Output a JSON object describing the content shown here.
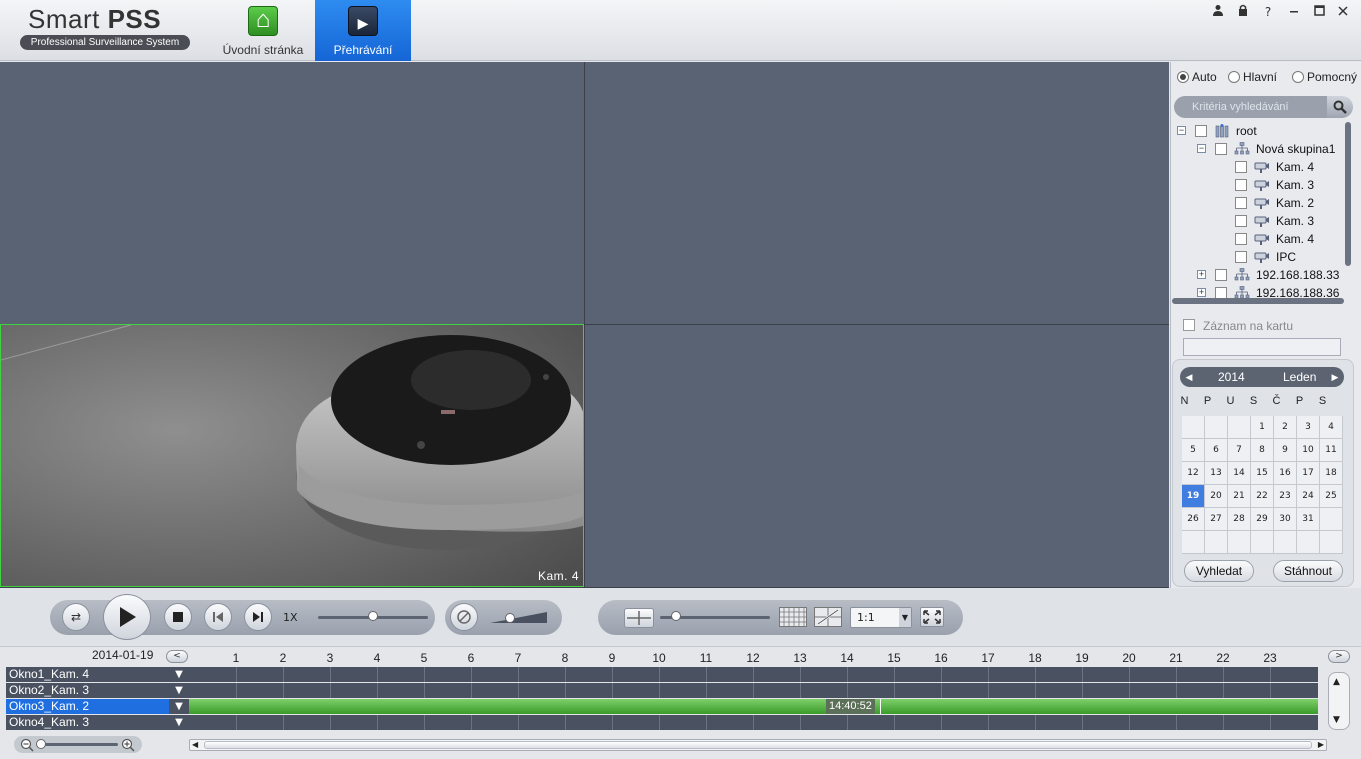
{
  "header": {
    "brand": "Smart",
    "brand_bold": "PSS",
    "subtitle": "Professional Surveillance System",
    "tabs": [
      {
        "label": "Úvodní stránka",
        "active": false
      },
      {
        "label": "Přehrávání",
        "active": true
      }
    ],
    "window_controls": [
      "user-icon",
      "lock-icon",
      "help-icon",
      "minimize-icon",
      "maximize-icon",
      "close-icon"
    ],
    "help_glyph": "?"
  },
  "video": {
    "active_pane_label": "Kam. 4"
  },
  "right_panel": {
    "stream_options": [
      {
        "label": "Auto",
        "checked": true
      },
      {
        "label": "Hlavní",
        "checked": false
      },
      {
        "label": "Pomocný",
        "checked": false
      }
    ],
    "search_placeholder": "Kritéria vyhledávání",
    "tree": [
      {
        "label": "root",
        "level": 0,
        "expand": "−",
        "icon": "server-icon"
      },
      {
        "label": "Nová skupina1",
        "level": 1,
        "expand": "−",
        "icon": "network-icon"
      },
      {
        "label": "Kam. 4",
        "level": 2,
        "icon": "camera-icon"
      },
      {
        "label": "Kam. 3",
        "level": 2,
        "icon": "camera-icon"
      },
      {
        "label": "Kam. 2",
        "level": 2,
        "icon": "camera-icon"
      },
      {
        "label": "Kam. 3",
        "level": 2,
        "icon": "camera-icon"
      },
      {
        "label": "Kam. 4",
        "level": 2,
        "icon": "camera-icon"
      },
      {
        "label": "IPC",
        "level": 2,
        "icon": "camera-icon"
      },
      {
        "label": "192.168.188.33",
        "level": 1,
        "expand": "+",
        "icon": "network-icon"
      },
      {
        "label": "192.168.188.36",
        "level": 1,
        "expand": "+",
        "icon": "network-icon"
      }
    ],
    "record_on_card_label": "Záznam na kartu",
    "calendar": {
      "year": "2014",
      "month": "Leden",
      "weekdays": [
        "N",
        "P",
        "U",
        "S",
        "Č",
        "P",
        "S"
      ],
      "days": [
        [
          "",
          "",
          "",
          "1",
          "2",
          "3",
          "4"
        ],
        [
          "5",
          "6",
          "7",
          "8",
          "9",
          "10",
          "11"
        ],
        [
          "12",
          "13",
          "14",
          "15",
          "16",
          "17",
          "18"
        ],
        [
          "19",
          "20",
          "21",
          "22",
          "23",
          "24",
          "25"
        ],
        [
          "26",
          "27",
          "28",
          "29",
          "30",
          "31",
          ""
        ],
        [
          "",
          "",
          "",
          "",
          "",
          "",
          ""
        ]
      ],
      "selected_day": "19"
    },
    "search_button": "Vyhledat",
    "download_button": "Stáhnout"
  },
  "toolbar": {
    "speed_label": "1X",
    "ratio_value": "1:1"
  },
  "timeline": {
    "date": "2014-01-19",
    "hours": [
      "1",
      "2",
      "3",
      "4",
      "5",
      "6",
      "7",
      "8",
      "9",
      "10",
      "11",
      "12",
      "13",
      "14",
      "15",
      "16",
      "17",
      "18",
      "19",
      "20",
      "21",
      "22",
      "23"
    ],
    "rows": [
      {
        "label": "Okno1_Kam. 4",
        "selected": false
      },
      {
        "label": "Okno2_Kam. 3",
        "selected": false
      },
      {
        "label": "Okno3_Kam. 2",
        "selected": true
      },
      {
        "label": "Okno4_Kam. 3",
        "selected": false
      }
    ],
    "cursor_time": "14:40:52"
  }
}
